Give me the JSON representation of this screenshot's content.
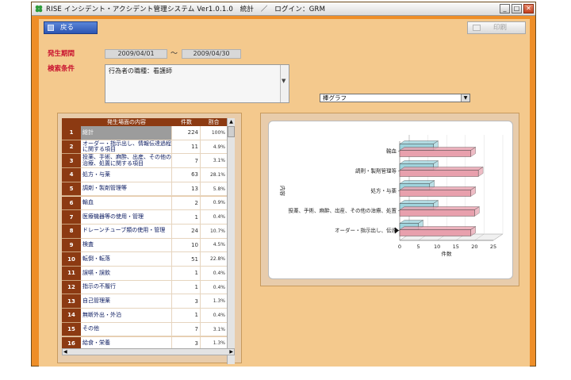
{
  "window": {
    "title": "RISE インシデント・アクシデント管理システム  Ver1.0.1.0　統計　／　ログイン：GRM",
    "minimize_glyph": "_",
    "maximize_glyph": "□",
    "close_glyph": "✕"
  },
  "toolbar": {
    "back_label": "戻る",
    "print_label": "印刷"
  },
  "filters": {
    "period_label": "発生期間",
    "date_from": "2009/04/01",
    "tilde": "～",
    "date_to": "2009/04/30",
    "condition_label": "検索条件",
    "condition_text": "行為者の職種：看護師",
    "chart_type": "棒グラフ"
  },
  "table": {
    "headers": [
      "発生場面の内容",
      "件数",
      "割合"
    ],
    "rows": [
      {
        "no": "1",
        "content": "総計",
        "count": "224",
        "pct": "100%"
      },
      {
        "no": "2",
        "content": "オーダー・指示出し、情報伝達過程に関する項目",
        "count": "11",
        "pct": "4.9%"
      },
      {
        "no": "3",
        "content": "投薬、手術、麻酔、出産、その他の治療、処置に関する項目",
        "count": "7",
        "pct": "3.1%"
      },
      {
        "no": "4",
        "content": "処方・与薬",
        "count": "63",
        "pct": "28.1%"
      },
      {
        "no": "5",
        "content": "調剤・製剤管理等",
        "count": "13",
        "pct": "5.8%"
      },
      {
        "no": "6",
        "content": "輸血",
        "count": "2",
        "pct": "0.9%"
      },
      {
        "no": "7",
        "content": "医療機器等の使用・管理",
        "count": "1",
        "pct": "0.4%"
      },
      {
        "no": "8",
        "content": "ドレーンチューブ類の使用・管理",
        "count": "24",
        "pct": "10.7%"
      },
      {
        "no": "9",
        "content": "検査",
        "count": "10",
        "pct": "4.5%"
      },
      {
        "no": "10",
        "content": "転倒・転落",
        "count": "51",
        "pct": "22.8%"
      },
      {
        "no": "11",
        "content": "誤嚥・誤飲",
        "count": "1",
        "pct": "0.4%"
      },
      {
        "no": "12",
        "content": "指示の不履行",
        "count": "1",
        "pct": "0.4%"
      },
      {
        "no": "13",
        "content": "自己管理薬",
        "count": "3",
        "pct": "1.3%"
      },
      {
        "no": "14",
        "content": "無断外出・外泊",
        "count": "1",
        "pct": "0.4%"
      },
      {
        "no": "15",
        "content": "その他",
        "count": "7",
        "pct": "3.1%"
      },
      {
        "no": "16",
        "content": "給食・栄養",
        "count": "3",
        "pct": "1.3%"
      }
    ]
  },
  "chart_data": {
    "type": "bar",
    "orientation": "horizontal",
    "categories": [
      "輸血",
      "調剤・製剤管理等",
      "処方・与薬",
      "投薬、手術、麻酔、出産、その他の治療、処置",
      "オーダー・指示出し、伝達"
    ],
    "series": [
      {
        "values": [
          9,
          9,
          8,
          9,
          5
        ],
        "color": "#9fd3dc"
      },
      {
        "values": [
          19,
          21,
          19,
          20,
          19
        ],
        "color": "#e8a0ad"
      }
    ],
    "xlabel": "件数",
    "ylabel": "内容",
    "x_ticks": [
      "0",
      "5",
      "10",
      "15",
      "20",
      "25"
    ],
    "xlim": [
      0,
      25
    ],
    "grid": true
  }
}
